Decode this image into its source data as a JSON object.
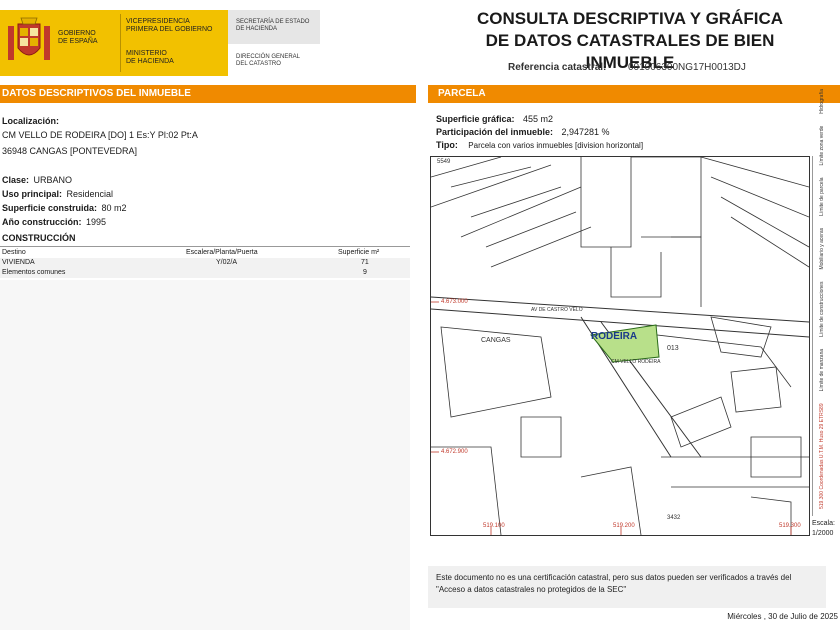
{
  "header": {
    "gobierno": [
      "GOBIERNO",
      "DE ESPAÑA"
    ],
    "vicepresidencia": [
      "VICEPRESIDENCIA",
      "PRIMERA DEL GOBIERNO"
    ],
    "ministerio": [
      "MINISTERIO",
      "DE HACIENDA"
    ],
    "secretaria": [
      "SECRETARÍA DE ESTADO",
      "DE HACIENDA"
    ],
    "direccion": [
      "DIRECCIÓN GENERAL",
      "DEL CATASTRO"
    ],
    "title_line1": "CONSULTA DESCRIPTIVA Y GRÁFICA",
    "title_line2": "DE DATOS CATASTRALES DE BIEN INMUEBLE",
    "ref_label": "Referencia catastral:",
    "ref_value": "001006300NG17H0013DJ"
  },
  "left": {
    "bar_title": "DATOS DESCRIPTIVOS DEL INMUEBLE",
    "localizacion_label": "Localización:",
    "localizacion_line1": "CM VELLO DE RODEIRA [DO] 1 Es:Y Pl:02 Pt:A",
    "localizacion_line2": "36948 CANGAS [PONTEVEDRA]",
    "clase_label": "Clase:",
    "clase_value": "URBANO",
    "uso_label": "Uso principal:",
    "uso_value": "Residencial",
    "superficie_label": "Superficie construida:",
    "superficie_value": "80 m2",
    "anio_label": "Año construcción:",
    "anio_value": "1995",
    "construccion_title": "CONSTRUCCIÓN",
    "table_headers": [
      "Destino",
      "Escalera/Planta/Puerta",
      "Superficie m²"
    ],
    "table_rows": [
      [
        "VIVIENDA",
        "Y/02/A",
        "71"
      ],
      [
        "Elementos comunes",
        "",
        "9"
      ]
    ]
  },
  "right": {
    "bar_title": "PARCELA",
    "sup_label": "Superficie gráfica:",
    "sup_value": "455 m2",
    "part_label": "Participación del inmueble:",
    "part_value": "2,947281 %",
    "tipo_label": "Tipo:",
    "tipo_value": "Parcela con varios inmuebles [division horizontal]",
    "map": {
      "place_label": "RODEIRA",
      "parcel_label": "013",
      "cangas_label": "CANGAS",
      "street1": "AV DE CASTRO VELO",
      "street2": "CM VELLO RODEIRA",
      "coord_y1": "4.673.000",
      "coord_y2": "4.672.900",
      "coord_x1": "519.100",
      "coord_x2": "519.200",
      "coord_x3": "519.300",
      "top_label": "5549",
      "bottom_label": "3432",
      "legend_items": [
        "Hidrografía",
        "Límite zona verde",
        "Límite de parcela",
        "Mobiliario y aceras",
        "Límite de construcciones",
        "Límite de manzana",
        "519.300 Coordenadas U.T.M. Huso 29 ETRS89"
      ],
      "highlight_color": "#b8e08a"
    },
    "scale_label": "Escala:",
    "scale_value": "1/2000",
    "note": "Este documento no es una certificación catastral, pero sus datos pueden ser verificados a través del \"Acceso a datos catastrales no protegidos de la SEC\"",
    "date": "Miércoles , 30 de Julio de 2025"
  },
  "colors": {
    "accent": "#f08a00",
    "logo_yellow": "#f2c100"
  }
}
